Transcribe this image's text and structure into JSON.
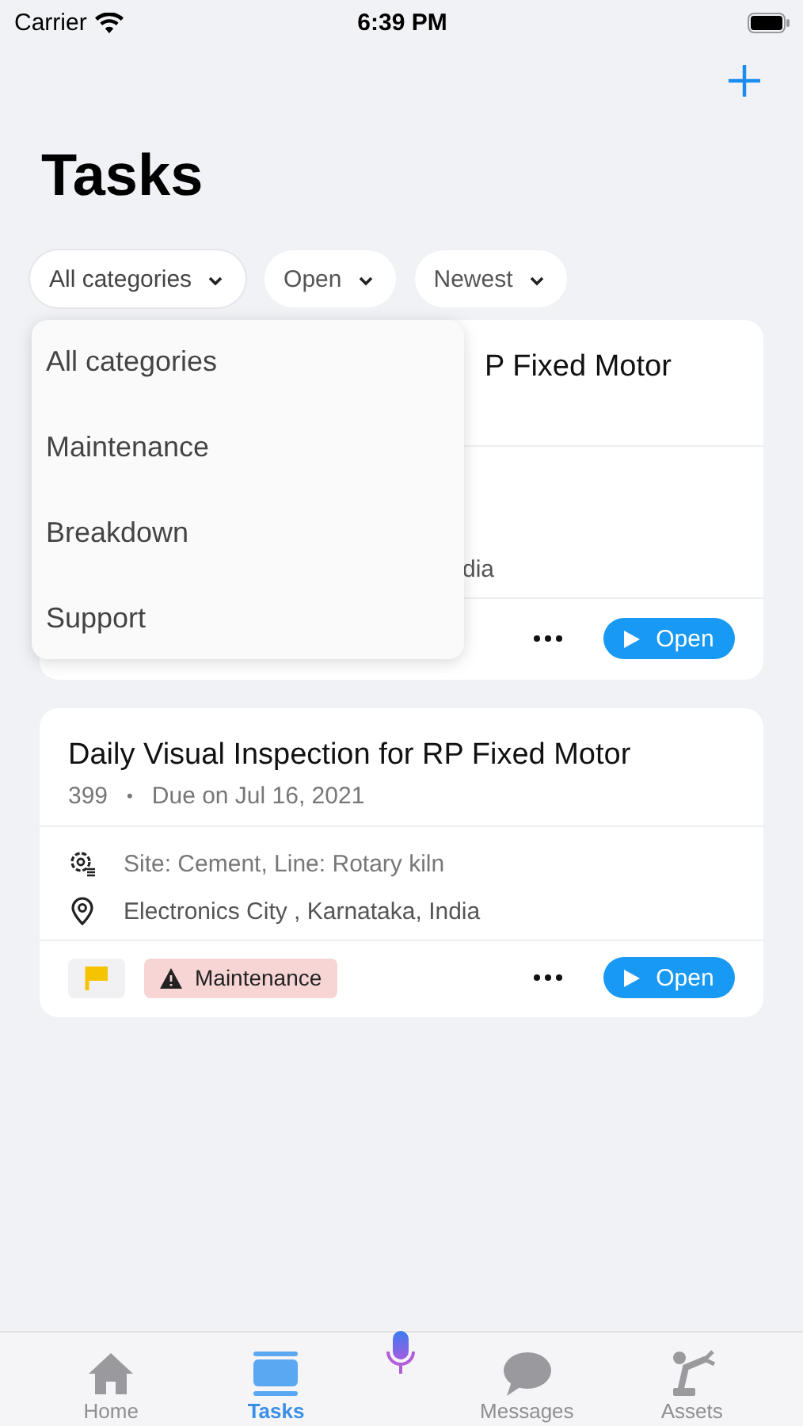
{
  "status_bar": {
    "carrier": "Carrier",
    "time": "6:39 PM"
  },
  "title": "Tasks",
  "filters": [
    {
      "label": "All categories",
      "expanded": true
    },
    {
      "label": "Open",
      "expanded": false
    },
    {
      "label": "Newest",
      "expanded": false
    }
  ],
  "dropdown": {
    "items": [
      "All categories",
      "Maintenance",
      "Breakdown",
      "Support"
    ]
  },
  "tasks": [
    {
      "covered": true,
      "title": "P Fixed Motor",
      "location": "dia",
      "action": "Open"
    },
    {
      "title": "Daily Visual Inspection for RP Fixed Motor",
      "number": "399",
      "separator": "•",
      "due": "Due on Jul 16, 2021",
      "site": "Site: Cement, Line: Rotary kiln",
      "location": "Electronics City , Karnataka, India",
      "category": "Maintenance",
      "action": "Open"
    }
  ],
  "tab_bar": [
    {
      "label": "Home",
      "kind": "home",
      "selected": false
    },
    {
      "label": "Tasks",
      "kind": "tasks",
      "selected": true
    },
    {
      "kind": "mic"
    },
    {
      "label": "Messages",
      "kind": "messages",
      "selected": false
    },
    {
      "label": "Assets",
      "kind": "assets",
      "selected": false
    }
  ]
}
